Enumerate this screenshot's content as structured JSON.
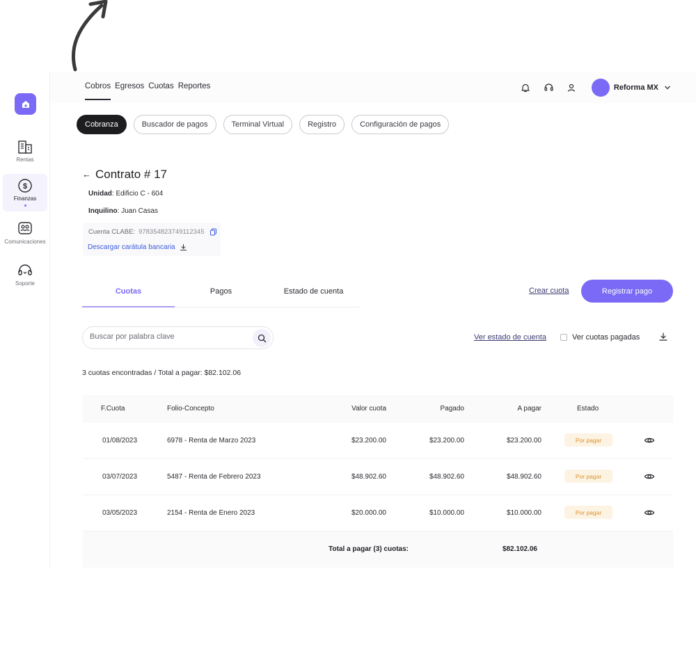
{
  "colors": {
    "accent": "#7a6af5",
    "badge_bg": "#fdf3e3",
    "badge_text": "#d8932f",
    "link": "#3b5bdb"
  },
  "sidebar": {
    "items": [
      {
        "label": "Rentas",
        "icon": "building-icon"
      },
      {
        "label": "Finanzas",
        "icon": "dollar-circle-icon",
        "active": true
      },
      {
        "label": "Comunicaciones",
        "icon": "people-chat-icon"
      },
      {
        "label": "Soporte",
        "icon": "headset-icon"
      }
    ]
  },
  "topnav": {
    "tabs": [
      "Cobros",
      "Egresos",
      "Cuotas",
      "Reportes"
    ],
    "account_name": "Reforma MX"
  },
  "pills": [
    "Cobranza",
    "Buscador de pagos",
    "Terminal Virtual",
    "Registro",
    "Configuración de pagos"
  ],
  "contract": {
    "back_arrow": "←",
    "title": "Contrato # 17",
    "unidad_label": "Unidad",
    "unidad_value": ": Edificio C - 604",
    "inquilino_label": "Inquilino",
    "inquilino_value": ": Juan Casas",
    "clabe_label": "Cuenta CLABE:",
    "clabe_value": "978354823749112345",
    "download_label": "Descargar carátula bancaria"
  },
  "subtabs": [
    "Cuotas",
    "Pagos",
    "Estado de cuenta"
  ],
  "actions": {
    "crear": "Crear cuota",
    "registrar": "Registrar pago"
  },
  "search": {
    "placeholder": "Buscar por palabra clave",
    "value": ""
  },
  "filters": {
    "ver_estado": "Ver estado de cuenta",
    "ver_pagadas": "Ver cuotas pagadas"
  },
  "summary": "3 cuotas encontradas / Total a pagar: $82.102.06",
  "table": {
    "headers": [
      "F.Cuota",
      "Folio-Concepto",
      "Valor cuota",
      "Pagado",
      "A pagar",
      "Estado"
    ],
    "rows": [
      {
        "fecha": "01/08/2023",
        "concepto": "6978 - Renta de Marzo 2023",
        "valor": "$23.200.00",
        "pagado": "$23.200.00",
        "apagar": "$23.200.00",
        "estado": "Por pagar"
      },
      {
        "fecha": "03/07/2023",
        "concepto": "5487 - Renta de Febrero 2023",
        "valor": "$48.902.60",
        "pagado": "$48.902.60",
        "apagar": "$48.902.60",
        "estado": "Por pagar"
      },
      {
        "fecha": "03/05/2023",
        "concepto": "2154 - Renta de Enero 2023",
        "valor": "$20.000.00",
        "pagado": "$10.000.00",
        "apagar": "$10.000.00",
        "estado": "Por pagar"
      }
    ],
    "footer_label": "Total a pagar (3) cuotas:",
    "footer_total": "$82.102.06"
  }
}
